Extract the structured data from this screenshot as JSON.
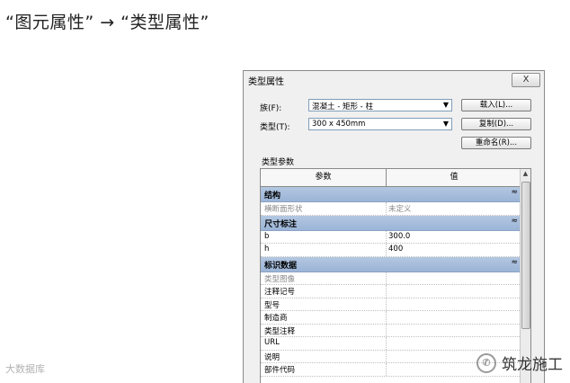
{
  "heading": "“图元属性” → “类型属性”",
  "dialog": {
    "title": "类型属性",
    "close_label": "X",
    "family_label": "族(F):",
    "family_value": "混凝土 - 矩形 - 柱",
    "type_label": "类型(T):",
    "type_value": "300 x 450mm",
    "load_button": "载入(L)...",
    "duplicate_button": "复制(D)...",
    "rename_button": "重命名(R)...",
    "type_params_label": "类型参数",
    "grid": {
      "col_param": "参数",
      "col_value": "值",
      "groups": [
        {
          "label": "结构",
          "toggle": "≈",
          "rows": [
            {
              "param": "横断面形状",
              "value": "未定义"
            }
          ]
        },
        {
          "label": "尺寸标注",
          "toggle": "≈",
          "rows": [
            {
              "param": "b",
              "value": "300.0"
            },
            {
              "param": "h",
              "value": "400"
            }
          ]
        },
        {
          "label": "标识数据",
          "toggle": "≈",
          "rows": [
            {
              "param": "类型图像",
              "value": ""
            },
            {
              "param": "注释记号",
              "value": ""
            },
            {
              "param": "型号",
              "value": ""
            },
            {
              "param": "制造商",
              "value": ""
            },
            {
              "param": "类型注释",
              "value": ""
            },
            {
              "param": "URL",
              "value": ""
            },
            {
              "param": "说明",
              "value": ""
            },
            {
              "param": "部件代码",
              "value": ""
            }
          ]
        }
      ]
    }
  },
  "watermarks": {
    "right": "筑龙施工",
    "left": "大数据库"
  }
}
